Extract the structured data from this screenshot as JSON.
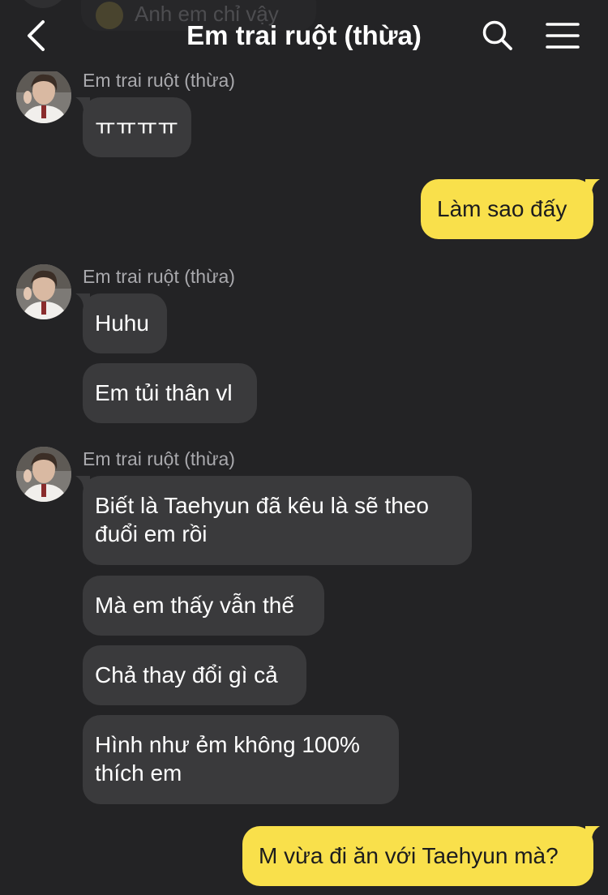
{
  "header": {
    "title": "Em trai ruột (thừa)",
    "previous_message_preview": "Anh em chỉ vậy"
  },
  "colors": {
    "background": "#232325",
    "incoming_bubble": "#3a3a3c",
    "outgoing_bubble": "#f9e04b",
    "sender_name": "#a9a9ad"
  },
  "messages": {
    "group1": {
      "sender": "Em trai ruột (thừa)",
      "m1": "ㅠㅠㅠㅠ"
    },
    "out1": "Làm sao đấy",
    "group2": {
      "sender": "Em trai ruột (thừa)",
      "m1": "Huhu",
      "m2": "Em tủi thân vl"
    },
    "group3": {
      "sender": "Em trai ruột (thừa)",
      "m1_line1": "Biết là Taehyun đã kêu là sẽ theo",
      "m1_line2": "đuổi em rồi",
      "m2": "Mà em thấy vẫn thế",
      "m3": "Chả thay đổi gì cả",
      "m4_line1": "Hình như ẻm không 100%",
      "m4_line2": "thích em"
    },
    "out2": "M vừa đi ăn với Taehyun mà?"
  }
}
